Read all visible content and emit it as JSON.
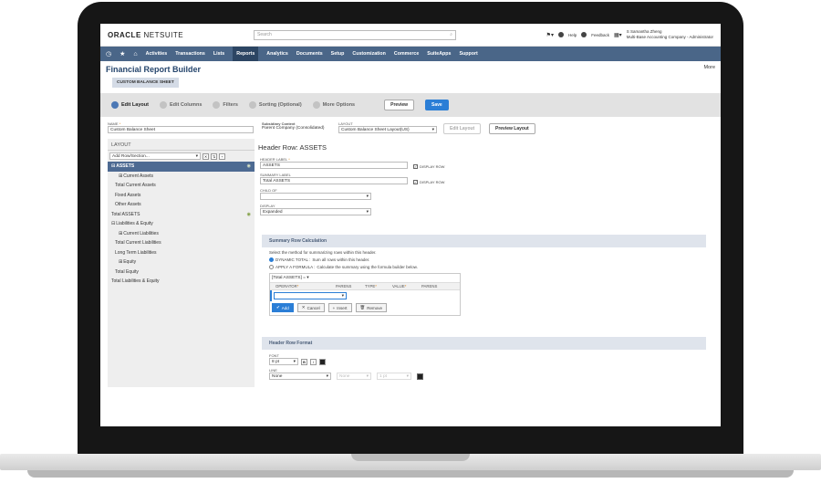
{
  "header": {
    "logo_oracle": "ORACLE",
    "logo_netsuite": "NETSUITE",
    "search_placeholder": "Search",
    "help": "Help",
    "feedback": "Feedback",
    "user_name": "S Samantha Zheng",
    "user_company": "Multi-Base Accounting Company - Administrator"
  },
  "nav": {
    "items": [
      "Activities",
      "Transactions",
      "Lists",
      "Reports",
      "Analytics",
      "Documents",
      "Setup",
      "Customization",
      "Commerce",
      "SuiteApps",
      "Support"
    ],
    "active": "Reports"
  },
  "page": {
    "title": "Financial Report Builder",
    "subtitle": "CUSTOM BALANCE SHEET",
    "more": "More"
  },
  "steps": {
    "items": [
      "Edit Layout",
      "Edit Columns",
      "Filters",
      "Sorting (Optional)",
      "More Options"
    ],
    "preview": "Preview",
    "save": "Save"
  },
  "form": {
    "name_label": "NAME",
    "name_value": "Custom Balance Sheet",
    "subsidiary_label": "Subsidiary Context",
    "subsidiary_value": "Parent Company (Consolidated)",
    "layout_label": "LAYOUT",
    "layout_value": "Custom Balance Sheet Layout(US)",
    "edit_layout": "Edit Layout",
    "preview_layout": "Preview Layout"
  },
  "left_panel": {
    "title": "LAYOUT",
    "add_row_value": "Add Row/Section...",
    "tree": [
      {
        "label": "ASSETS",
        "indent": 0,
        "prefix": "⊟",
        "selected": true
      },
      {
        "label": "Current Assets",
        "indent": 2,
        "prefix": "⊞",
        "selected": false
      },
      {
        "label": "Total Current Assets",
        "indent": 1,
        "prefix": "",
        "selected": false
      },
      {
        "label": "Fixed Assets",
        "indent": 1,
        "prefix": "",
        "selected": false
      },
      {
        "label": "Other Assets",
        "indent": 1,
        "prefix": "",
        "selected": false
      },
      {
        "label": "Total ASSETS",
        "indent": 0,
        "prefix": "",
        "selected": false
      },
      {
        "label": "Liabilities & Equity",
        "indent": 0,
        "prefix": "⊟",
        "selected": false
      },
      {
        "label": "Current Liabilities",
        "indent": 2,
        "prefix": "⊞",
        "selected": false
      },
      {
        "label": "Total Current Liabilities",
        "indent": 1,
        "prefix": "",
        "selected": false
      },
      {
        "label": "Long Term Liabilities",
        "indent": 1,
        "prefix": "",
        "selected": false
      },
      {
        "label": "Equity",
        "indent": 2,
        "prefix": "⊞",
        "selected": false
      },
      {
        "label": "Total Equity",
        "indent": 1,
        "prefix": "",
        "selected": false
      },
      {
        "label": "Total Liabilities & Equity",
        "indent": 0,
        "prefix": "",
        "selected": false
      }
    ]
  },
  "detail": {
    "heading": "Header Row: ASSETS",
    "header_label_label": "HEADER LABEL",
    "header_label_value": "ASSETS",
    "display_row": "DISPLAY ROW",
    "summary_label_label": "SUMMARY LABEL",
    "summary_label_value": "Total ASSETS",
    "child_of_label": "CHILD OF",
    "child_of_value": "",
    "display_label": "DISPLAY",
    "display_value": "Expanded"
  },
  "summary_calc": {
    "title": "Summary Row Calculation",
    "instruction": "Select the method for summarizing rows within this header.",
    "opt1_label": "DYNAMIC TOTAL :",
    "opt1_desc": "Sum all rows within this header.",
    "opt2_label": "APPLY A FORMULA :",
    "opt2_desc": "Calculate the summary using the formula builder below.",
    "formula_name": "[Total ASSETS] =",
    "columns": [
      "OPERATOR",
      "PARENS",
      "TYPE",
      "VALUE",
      "PARENS"
    ],
    "add": "Add",
    "cancel": "Cancel",
    "insert": "Insert",
    "remove": "Remove"
  },
  "row_format": {
    "title": "Header Row Format",
    "font_label": "FONT",
    "font_size": "8 pt",
    "bold": "B",
    "italic": "I",
    "line_label": "LINE",
    "line_value": "None",
    "line_style": "None",
    "line_weight": "1 pt"
  },
  "colors": {
    "nav_bg": "#4a6688",
    "accent": "#2b7ed6",
    "title": "#26466d"
  }
}
